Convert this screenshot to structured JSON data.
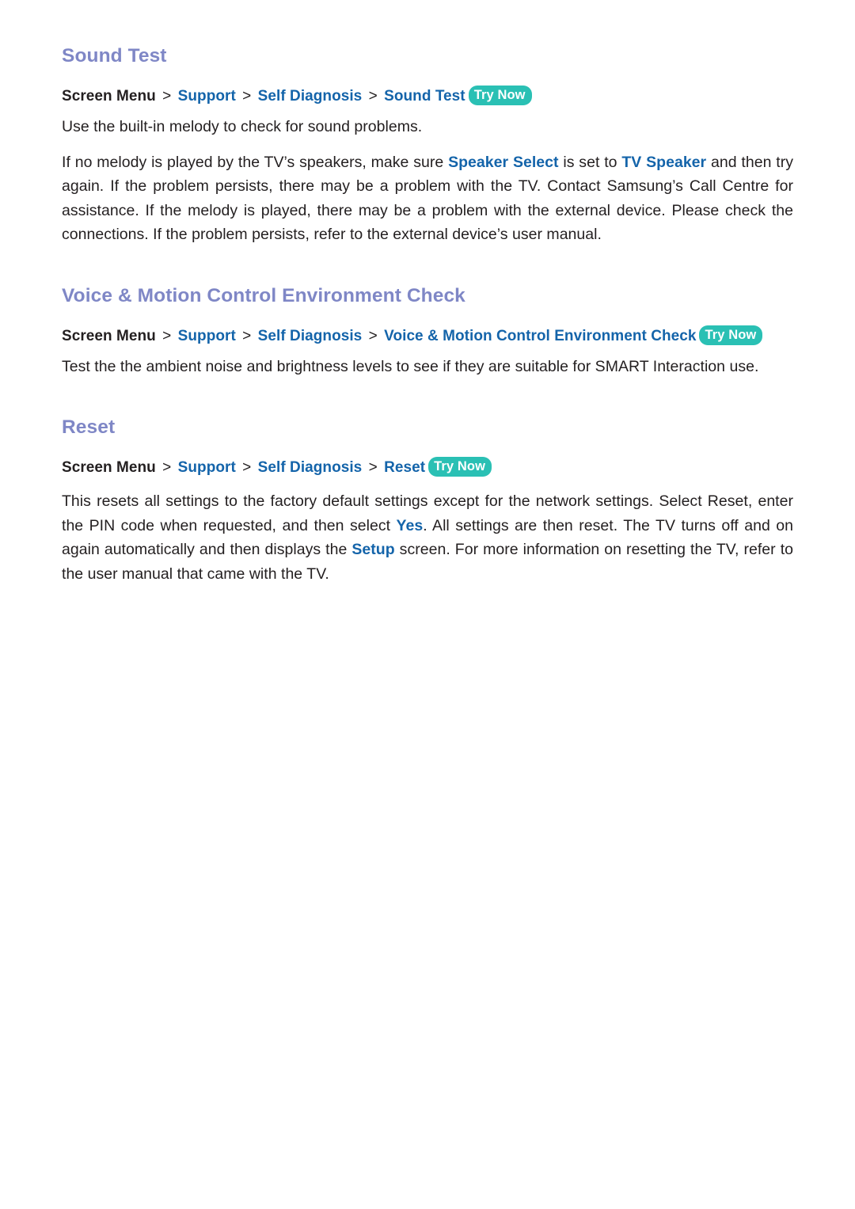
{
  "theme": {
    "background": "#ffffff",
    "heading_color": "#7f87c6",
    "link_color": "#1464aa",
    "body_color": "#231f20",
    "badge_bg": "#2ac0b4",
    "badge_text_color": "#ffffff"
  },
  "badge": {
    "label": "Try Now",
    "icon_name": "try-now-badge"
  },
  "breadcrumb_common": {
    "root": "Screen Menu",
    "separator": ">",
    "support": "Support",
    "self_diagnosis": "Self Diagnosis"
  },
  "sections": [
    {
      "id": "sound-test",
      "heading": "Sound Test",
      "breadcrumb": {
        "root": "Screen Menu",
        "sep1": ">",
        "item1": "Support",
        "sep2": ">",
        "item2": "Self Diagnosis",
        "sep3": ">",
        "item3": "Sound Test",
        "badge": "Try Now"
      },
      "paragraph1": "Use the built-in melody to check for sound problems.",
      "paragraph2": {
        "part1": "If no melody is played by the TV’s speakers, make sure ",
        "kw1": "Speaker Select",
        "part2": " is set to ",
        "kw2": "TV Speaker",
        "part3": " and then try again. If the problem persists, there may be a problem with the TV. Contact Samsung’s Call Centre for assistance. If the melody is played, there may be a problem with the external device. Please check the connections. If the problem persists, refer to the external device’s user manual."
      }
    },
    {
      "id": "voice-motion-control-environment-check",
      "heading": "Voice & Motion Control Environment Check",
      "breadcrumb": {
        "root": "Screen Menu",
        "sep1": ">",
        "item1": "Support",
        "sep2": ">",
        "item2": "Self Diagnosis",
        "sep3": ">",
        "item3": "Voice & Motion Control Environment Check",
        "badge": "Try Now"
      },
      "paragraph1": "Test the the ambient noise and brightness levels to see if they are suitable for SMART Interaction use."
    },
    {
      "id": "reset",
      "heading": "Reset",
      "breadcrumb": {
        "root": "Screen Menu",
        "sep1": ">",
        "item1": "Support",
        "sep2": ">",
        "item2": "Self Diagnosis",
        "sep3": ">",
        "item3": "Reset",
        "badge": "Try Now"
      },
      "paragraph1": {
        "part1": "This resets all settings to the factory default settings except for the network settings. Select Reset, enter the PIN code when requested, and then select ",
        "kw1": "Yes",
        "part2": ". All settings are then reset. The TV turns off and on again automatically and then displays the ",
        "kw2": "Setup",
        "part3": " screen. For more information on resetting the TV, refer to the user manual that came with the TV."
      }
    }
  ]
}
